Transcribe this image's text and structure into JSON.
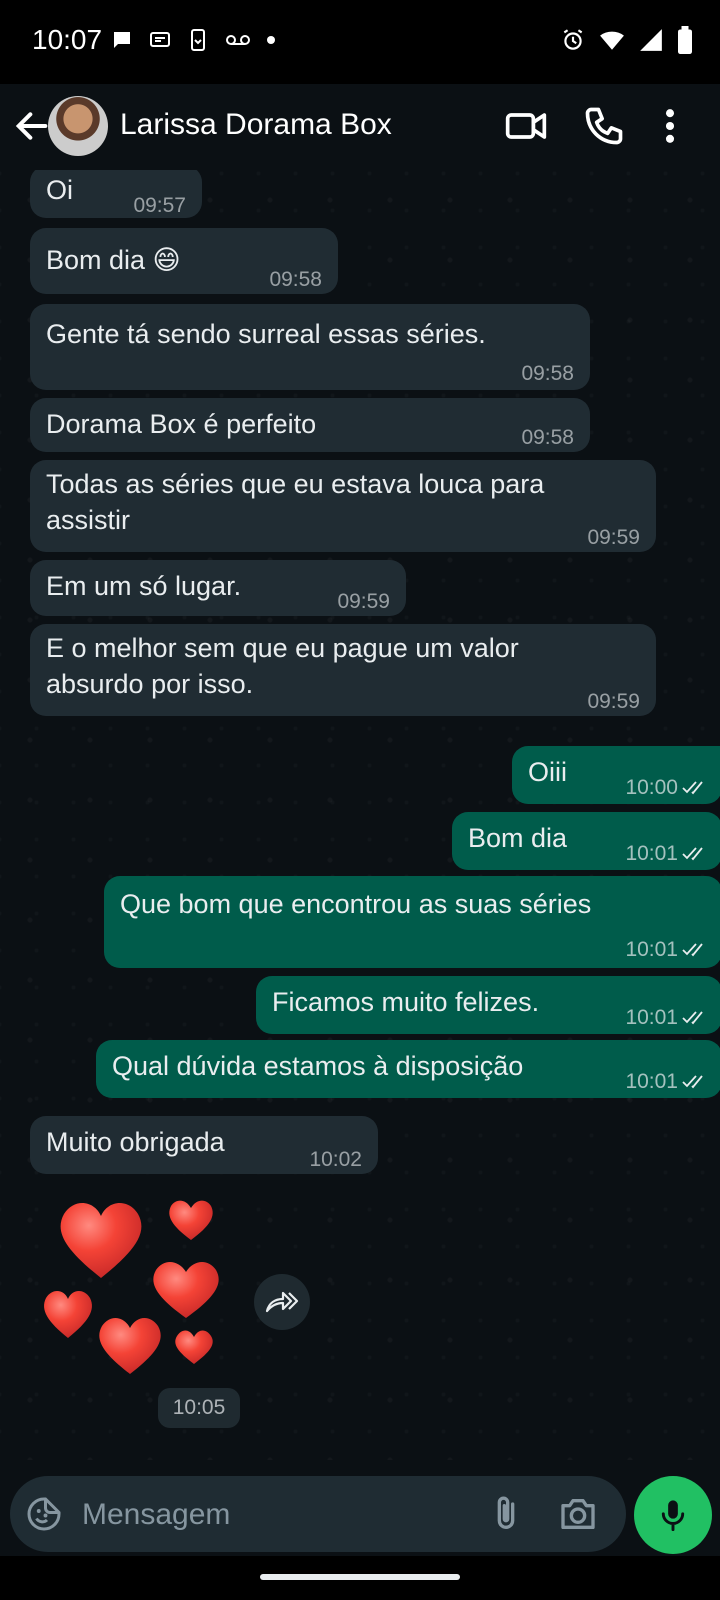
{
  "status_bar": {
    "time": "10:07"
  },
  "header": {
    "contact_name": "Larissa Dorama Box"
  },
  "messages": [
    {
      "text": "Oi",
      "time": "09:57"
    },
    {
      "text": "Bom dia 😄",
      "time": "09:58"
    },
    {
      "text": "Gente tá sendo surreal  essas séries.",
      "time": "09:58"
    },
    {
      "text": "Dorama Box  é  perfeito",
      "time": "09:58"
    },
    {
      "text_line1": "Todas as séries  que eu estava louca para",
      "text_line2": "assistir",
      "time": "09:59"
    },
    {
      "text": "Em um só  lugar.",
      "time": "09:59"
    },
    {
      "text_line1": "E o melhor sem que eu pague um valor",
      "text_line2": "absurdo  por isso.",
      "time": "09:59"
    },
    {
      "text": "Oiii",
      "time": "10:00"
    },
    {
      "text": "Bom dia",
      "time": "10:01"
    },
    {
      "text": "Que bom  que  encontrou as suas séries",
      "time": "10:01"
    },
    {
      "text": "Ficamos muito felizes.",
      "time": "10:01"
    },
    {
      "text": "Qual dúvida estamos à disposição",
      "time": "10:01"
    },
    {
      "text": "Muito obrigada",
      "time": "10:02"
    }
  ],
  "sticker": {
    "time": "10:05",
    "description_icon": "hearts-sticker-icon"
  },
  "composer": {
    "placeholder": "Mensagem"
  },
  "colors": {
    "incoming_bubble": "#202c33",
    "outgoing_bubble": "#005c4b",
    "mic_button": "#21c063"
  }
}
